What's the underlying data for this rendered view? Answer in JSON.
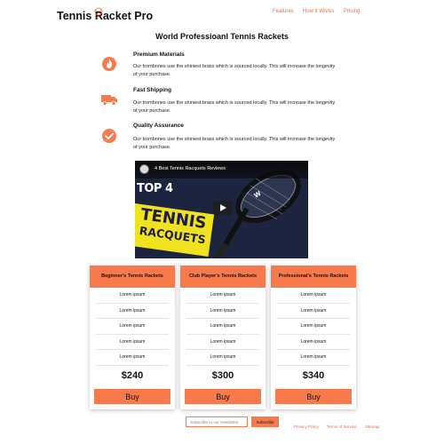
{
  "header": {
    "logo_text": "Tennis Racket Pro",
    "nav": [
      "Features",
      "How it Works",
      "Pricing"
    ]
  },
  "main": {
    "heading": "World Professioanl Tennis Rackets",
    "features": [
      {
        "icon": "flame-icon",
        "title": "Premium Materials",
        "text": "Our trombones use the shiniest brass which is sourced locally. This will increase the longevity of your purchase."
      },
      {
        "icon": "truck-icon",
        "title": "Fast Shipping",
        "text": "Our trombones use the shiniest brass which is sourced locally. This will increase the longevity of your purchase."
      },
      {
        "icon": "check-circle-icon",
        "title": "Quality Assurance",
        "text": "Our trombones use the shiniest brass which is sourced locally. This will increase the longevity of your purchase."
      }
    ],
    "video": {
      "title": "4 Best Tennis Racquets Reviews",
      "top_text": "TOP 4",
      "word1": "TENNIS",
      "word2": "RACQUETS"
    }
  },
  "pricing": [
    {
      "title": "Beginner's Tennis Rackets",
      "items": [
        "Lorem ipsum",
        "Lorem ipsum",
        "Lorem ipsum",
        "Lorem ipsum",
        "Lorem ipsum"
      ],
      "price": "$240",
      "button": "Buy"
    },
    {
      "title": "Club Player's Tennis Rackets",
      "items": [
        "Lorem ipsum",
        "Lorem ipsum",
        "Lorem ipsum",
        "Lorem ipsum",
        "Lorem ipsum"
      ],
      "price": "$300",
      "button": "Buy"
    },
    {
      "title": "Professional's Tennis Rackets",
      "items": [
        "Lorem ipsum",
        "Lorem ipsum",
        "Lorem ipsum",
        "Lorem ipsum",
        "Lorem ipsum"
      ],
      "price": "$340",
      "button": "Buy"
    }
  ],
  "footer": {
    "subscribe_placeholder": "Subscribe to our newsletter",
    "subscribe_button": "Subscribe",
    "links": [
      "Privacy Policy",
      "Terms of Service",
      "Sitemap"
    ]
  },
  "colors": {
    "accent": "#f77a4c",
    "link": "#f26b3a"
  }
}
